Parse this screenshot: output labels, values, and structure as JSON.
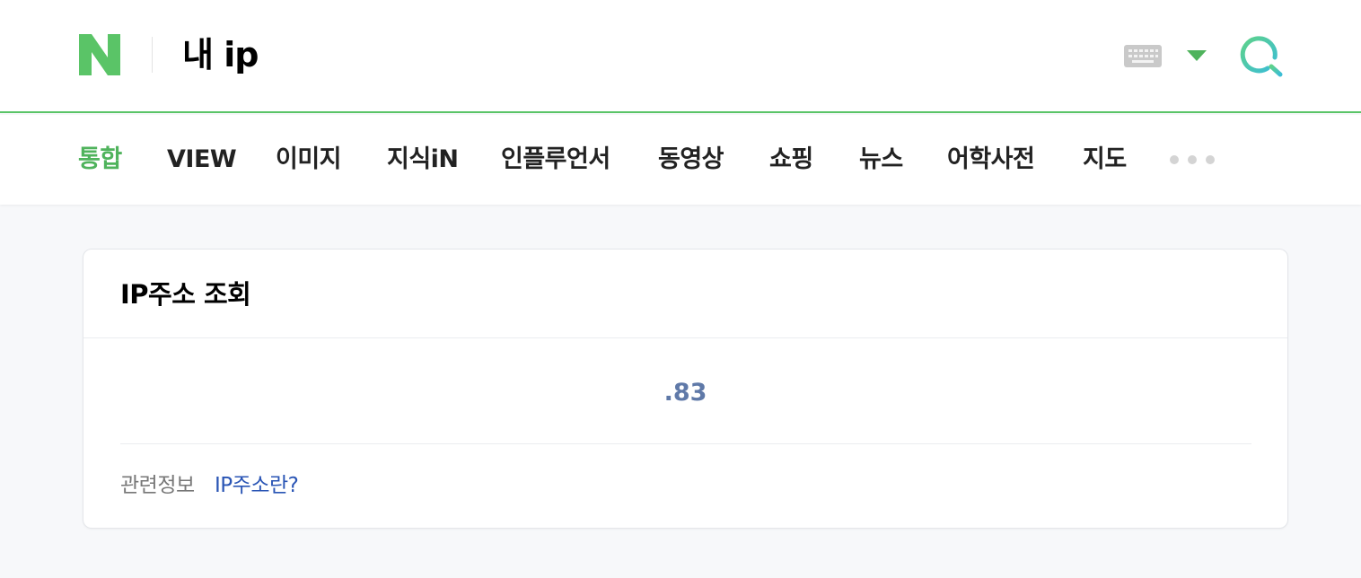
{
  "header": {
    "logo_icon": "naver-n-logo-icon",
    "query": "내 ip",
    "keyboard_icon": "keyboard-icon",
    "dropdown_icon": "triangle-down-icon",
    "search_icon": "search-icon",
    "colors": {
      "brand_green": "#5ac467",
      "search_gradient_start": "#5ed28a",
      "search_gradient_end": "#3bbdd6"
    }
  },
  "tabs": {
    "items": [
      {
        "label": "통합",
        "active": true
      },
      {
        "label": "VIEW",
        "active": false
      },
      {
        "label": "이미지",
        "active": false
      },
      {
        "label": "지식iN",
        "active": false
      },
      {
        "label": "인플루언서",
        "active": false
      },
      {
        "label": "동영상",
        "active": false
      },
      {
        "label": "쇼핑",
        "active": false
      },
      {
        "label": "뉴스",
        "active": false
      },
      {
        "label": "어학사전",
        "active": false
      },
      {
        "label": "지도",
        "active": false
      }
    ],
    "more_icon": "more-dots-icon"
  },
  "ip_card": {
    "title": "IP주소 조회",
    "ip_value": ".83",
    "related_label": "관련정보",
    "related_link": "IP주소란?"
  }
}
